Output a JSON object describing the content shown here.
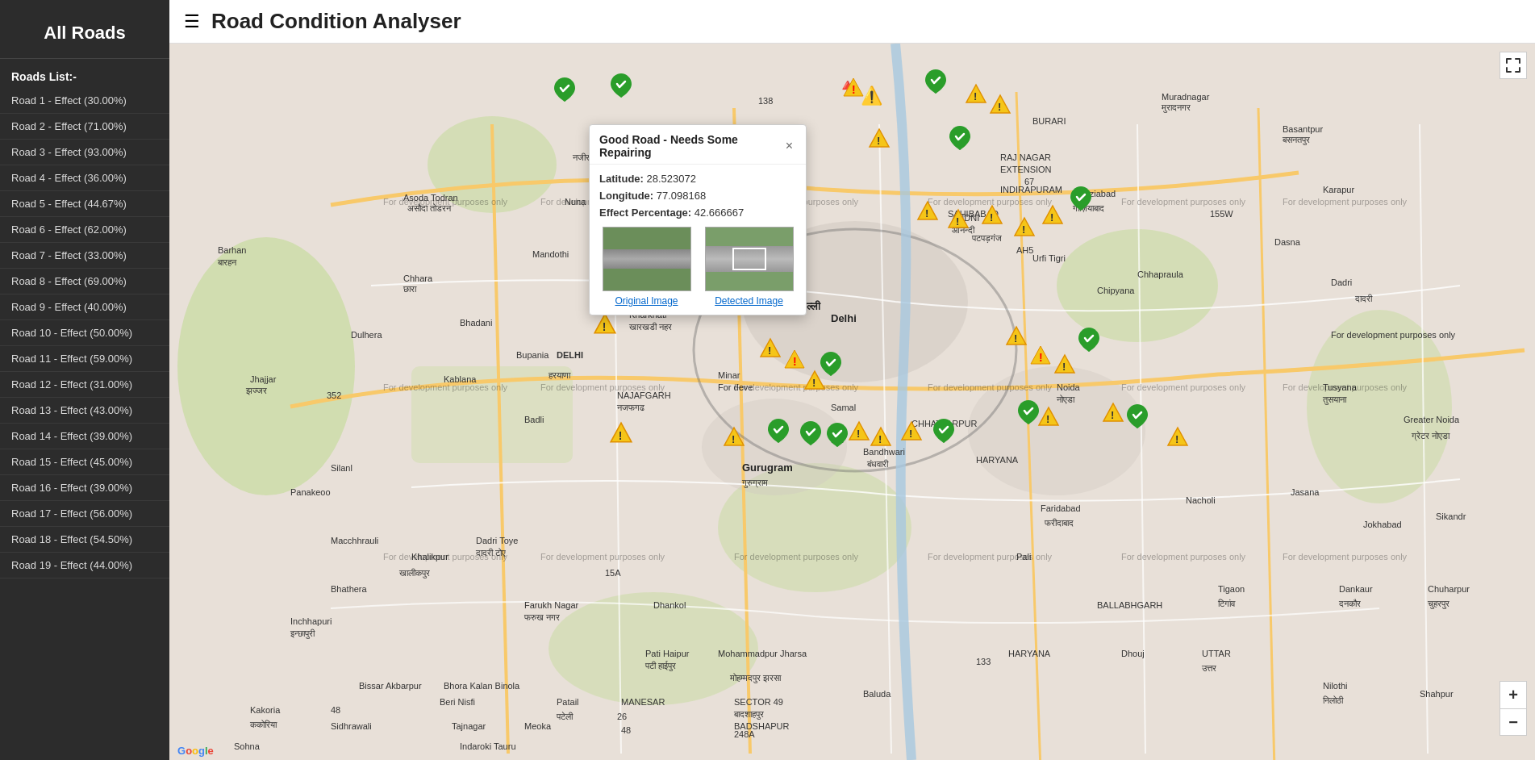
{
  "sidebar": {
    "title": "All Roads",
    "roads_list_label": "Roads List:-",
    "roads": [
      {
        "label": "Road 1 - Effect (30.00%)"
      },
      {
        "label": "Road 2 - Effect (71.00%)"
      },
      {
        "label": "Road 3 - Effect (93.00%)"
      },
      {
        "label": "Road 4 - Effect (36.00%)"
      },
      {
        "label": "Road 5 - Effect (44.67%)"
      },
      {
        "label": "Road 6 - Effect (62.00%)"
      },
      {
        "label": "Road 7 - Effect (33.00%)"
      },
      {
        "label": "Road 8 - Effect (69.00%)"
      },
      {
        "label": "Road 9 - Effect (40.00%)"
      },
      {
        "label": "Road 10 - Effect (50.00%)"
      },
      {
        "label": "Road 11 - Effect (59.00%)"
      },
      {
        "label": "Road 12 - Effect (31.00%)"
      },
      {
        "label": "Road 13 - Effect (43.00%)"
      },
      {
        "label": "Road 14 - Effect (39.00%)"
      },
      {
        "label": "Road 15 - Effect (45.00%)"
      },
      {
        "label": "Road 16 - Effect (39.00%)"
      },
      {
        "label": "Road 17 - Effect (56.00%)"
      },
      {
        "label": "Road 18 - Effect (54.50%)"
      },
      {
        "label": "Road 19 - Effect (44.00%)"
      }
    ]
  },
  "header": {
    "menu_icon": "☰",
    "title": "Road Condition Analyser"
  },
  "popup": {
    "title": "Good Road - Needs Some Repairing",
    "close_icon": "×",
    "latitude_label": "Latitude:",
    "latitude_value": "28.523072",
    "longitude_label": "Longitude:",
    "longitude_value": "77.098168",
    "effect_label": "Effect Percentage:",
    "effect_value": "42.666667",
    "original_image_label": "Original Image",
    "detected_image_label": "Detected Image"
  },
  "map": {
    "fullscreen_icon": "⛶",
    "zoom_in": "+",
    "zoom_out": "−",
    "watermarks": [
      "For development purposes only",
      "For development purposes only",
      "For development purposes only",
      "For development purposes only",
      "For development purposes only",
      "For development purposes only",
      "For development purposes only",
      "For development purposes only"
    ]
  }
}
